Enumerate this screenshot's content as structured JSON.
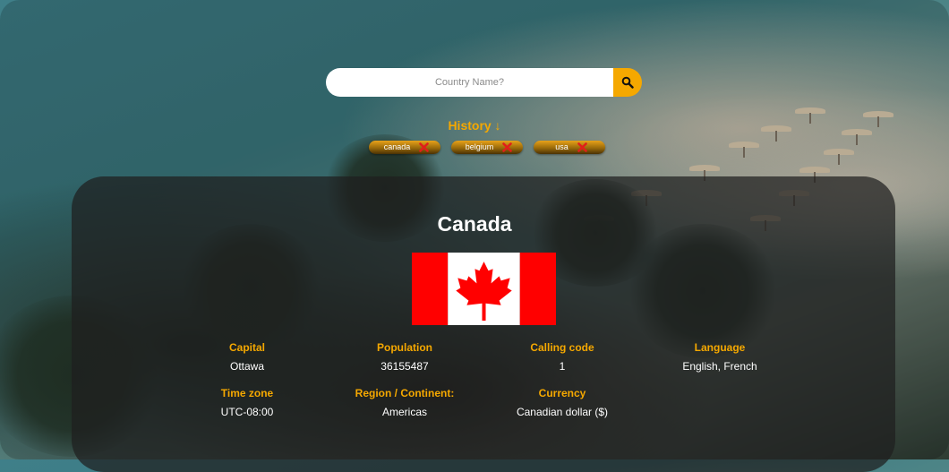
{
  "search": {
    "placeholder": "Country Name?",
    "button_icon": "search-icon"
  },
  "history": {
    "title": "History ↓",
    "items": [
      {
        "label": "canada"
      },
      {
        "label": "belgium"
      },
      {
        "label": "usa"
      }
    ],
    "remove_icon": "close-x-icon"
  },
  "country": {
    "name": "Canada",
    "flag_icon": "canada-flag",
    "details": [
      {
        "label": "Capital",
        "value": "Ottawa"
      },
      {
        "label": "Population",
        "value": "36155487"
      },
      {
        "label": "Calling code",
        "value": "1"
      },
      {
        "label": "Language",
        "value": "English, French"
      },
      {
        "label": "Time zone",
        "value": "UTC-08:00"
      },
      {
        "label": "Region / Continent:",
        "value": "Americas"
      },
      {
        "label": "Currency",
        "value": "Canadian dollar ($)"
      }
    ]
  },
  "colors": {
    "accent": "#f5a800",
    "flag_red": "#ff0000",
    "card_bg": "#1e1e1e"
  }
}
